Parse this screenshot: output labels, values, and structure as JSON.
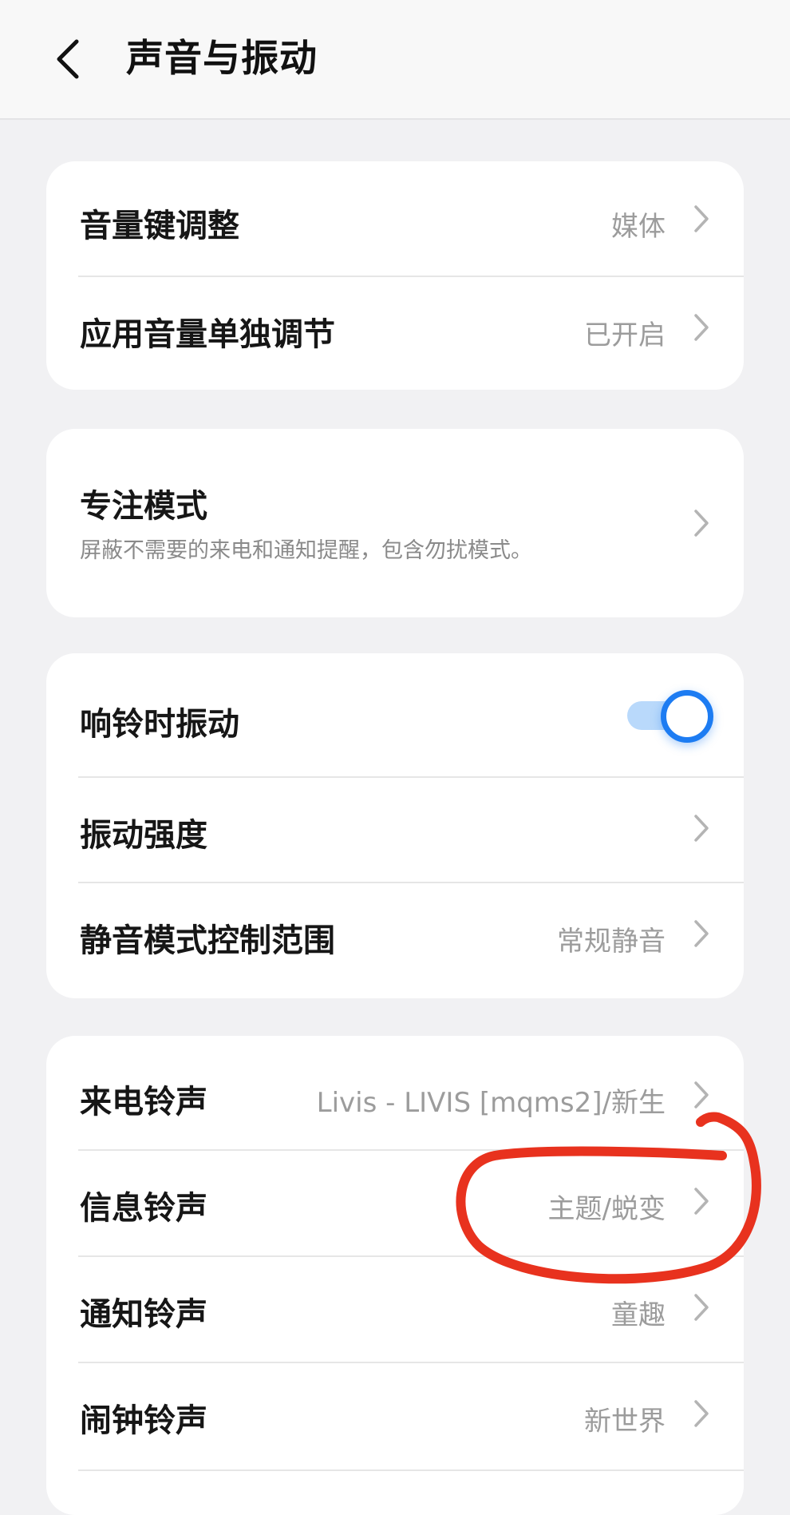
{
  "header": {
    "title": "声音与振动",
    "back_icon": "back-chevron-icon"
  },
  "group1": {
    "items": [
      {
        "label": "音量键调整",
        "value": "媒体"
      },
      {
        "label": "应用音量单独调节",
        "value": "已开启"
      }
    ]
  },
  "focus": {
    "label": "专注模式",
    "subtitle": "屏蔽不需要的来电和通知提醒，包含勿扰模式。"
  },
  "group3": {
    "vibrate_on_ring": {
      "label": "响铃时振动",
      "enabled": true
    },
    "vibration_strength": {
      "label": "振动强度"
    },
    "silent_mode": {
      "label": "静音模式控制范围",
      "value": "常规静音"
    }
  },
  "ringtones": {
    "items": [
      {
        "label": "来电铃声",
        "value": "Livis - LIVIS [mqms2]/新生"
      },
      {
        "label": "信息铃声",
        "value": "主题/蜕变"
      },
      {
        "label": "通知铃声",
        "value": "童趣"
      },
      {
        "label": "闹钟铃声",
        "value": "新世界"
      }
    ]
  },
  "colors": {
    "accent": "#1d7cf2",
    "annotation": "#e8321e",
    "background": "#f1f1f3"
  }
}
